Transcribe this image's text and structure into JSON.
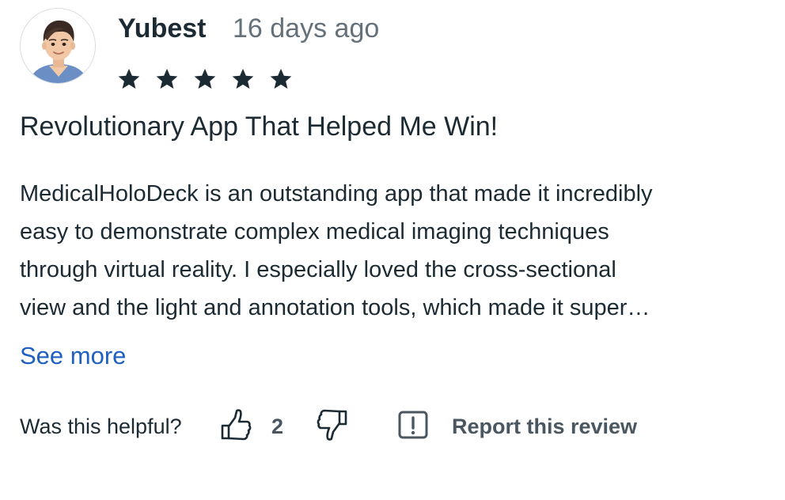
{
  "review": {
    "avatar_icon": "user-avatar",
    "username": "Yubest",
    "timestamp": "16 days ago",
    "rating": 5,
    "rating_max": 5,
    "title": "Revolutionary App That Helped Me Win!",
    "body_lines": [
      "MedicalHoloDeck is an outstanding app that made it incredibly",
      "easy to demonstrate complex medical imaging techniques",
      "through virtual reality. I especially loved the cross-sectional",
      "view and the light and annotation tools, which made it super…"
    ],
    "see_more_label": "See more"
  },
  "feedback": {
    "helpful_label": "Was this helpful?",
    "thumbs_up_icon": "thumbs-up-icon",
    "like_count": "2",
    "thumbs_down_icon": "thumbs-down-icon",
    "report_icon": "alert-box-icon",
    "report_label": "Report this review"
  },
  "colors": {
    "text": "#1c2b33",
    "muted": "#65717a",
    "link": "#1e5fbf",
    "icon": "#4a5660"
  }
}
